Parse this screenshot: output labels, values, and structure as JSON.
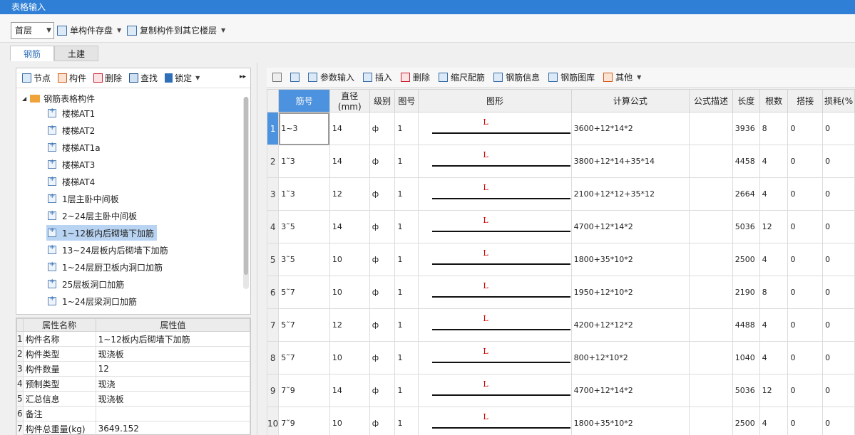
{
  "window": {
    "title": "表格输入"
  },
  "toolbar": {
    "floor_value": "首层",
    "save_single": "单构件存盘",
    "copy_to_floor": "复制构件到其它楼层"
  },
  "tabs": [
    "钢筋",
    "土建"
  ],
  "left_toolbar": {
    "node": "节点",
    "component": "构件",
    "delete": "删除",
    "find": "查找",
    "lock": "锁定"
  },
  "tree": {
    "root": "钢筋表格构件",
    "items": [
      "楼梯AT1",
      "楼梯AT2",
      "楼梯AT1a",
      "楼梯AT3",
      "楼梯AT4",
      "1层主卧中间板",
      "2~24层主卧中间板",
      "1~12板内后砌墙下加筋",
      "13~24层板内后砌墙下加筋",
      "1~24层厨卫板内洞口加筋",
      "25层板洞口加筋",
      "1~24层梁洞口加筋"
    ],
    "selected_index": 7
  },
  "props": {
    "headers": [
      "属性名称",
      "属性值"
    ],
    "rows": [
      {
        "n": "1",
        "name": "构件名称",
        "value": "1~12板内后砌墙下加筋"
      },
      {
        "n": "2",
        "name": "构件类型",
        "value": "现浇板"
      },
      {
        "n": "3",
        "name": "构件数量",
        "value": "12"
      },
      {
        "n": "4",
        "name": "预制类型",
        "value": "现浇"
      },
      {
        "n": "5",
        "name": "汇总信息",
        "value": "现浇板"
      },
      {
        "n": "6",
        "name": "备注",
        "value": ""
      },
      {
        "n": "7",
        "name": "构件总重量(kg)",
        "value": "3649.152"
      }
    ]
  },
  "right_toolbar": {
    "param_input": "参数输入",
    "insert": "插入",
    "delete": "删除",
    "scale_rebar": "缩尺配筋",
    "rebar_info": "钢筋信息",
    "rebar_lib": "钢筋图库",
    "other": "其他"
  },
  "grid": {
    "headers": [
      "筋号",
      "直径(mm)",
      "级别",
      "图号",
      "图形",
      "计算公式",
      "公式描述",
      "长度",
      "根数",
      "搭接",
      "损耗(%"
    ],
    "shape_label": "L",
    "grade_symbol": "ф",
    "rows": [
      {
        "n": "1",
        "id": "1~3",
        "dia": "14",
        "fig": "1",
        "formula": "3600+12*14*2",
        "desc": "",
        "len": "3936",
        "count": "8",
        "lap": "0",
        "loss": "0"
      },
      {
        "n": "2",
        "id": "1˜3",
        "dia": "14",
        "fig": "1",
        "formula": "3800+12*14+35*14",
        "desc": "",
        "len": "4458",
        "count": "4",
        "lap": "0",
        "loss": "0"
      },
      {
        "n": "3",
        "id": "1˜3",
        "dia": "12",
        "fig": "1",
        "formula": "2100+12*12+35*12",
        "desc": "",
        "len": "2664",
        "count": "4",
        "lap": "0",
        "loss": "0"
      },
      {
        "n": "4",
        "id": "3˜5",
        "dia": "14",
        "fig": "1",
        "formula": "4700+12*14*2",
        "desc": "",
        "len": "5036",
        "count": "12",
        "lap": "0",
        "loss": "0"
      },
      {
        "n": "5",
        "id": "3˜5",
        "dia": "10",
        "fig": "1",
        "formula": "1800+35*10*2",
        "desc": "",
        "len": "2500",
        "count": "4",
        "lap": "0",
        "loss": "0"
      },
      {
        "n": "6",
        "id": "5˜7",
        "dia": "10",
        "fig": "1",
        "formula": "1950+12*10*2",
        "desc": "",
        "len": "2190",
        "count": "8",
        "lap": "0",
        "loss": "0"
      },
      {
        "n": "7",
        "id": "5˜7",
        "dia": "12",
        "fig": "1",
        "formula": "4200+12*12*2",
        "desc": "",
        "len": "4488",
        "count": "4",
        "lap": "0",
        "loss": "0"
      },
      {
        "n": "8",
        "id": "5˜7",
        "dia": "10",
        "fig": "1",
        "formula": "800+12*10*2",
        "desc": "",
        "len": "1040",
        "count": "4",
        "lap": "0",
        "loss": "0"
      },
      {
        "n": "9",
        "id": "7˜9",
        "dia": "14",
        "fig": "1",
        "formula": "4700+12*14*2",
        "desc": "",
        "len": "5036",
        "count": "12",
        "lap": "0",
        "loss": "0"
      },
      {
        "n": "10",
        "id": "7˜9",
        "dia": "10",
        "fig": "1",
        "formula": "1800+35*10*2",
        "desc": "",
        "len": "2500",
        "count": "4",
        "lap": "0",
        "loss": "0"
      }
    ]
  }
}
